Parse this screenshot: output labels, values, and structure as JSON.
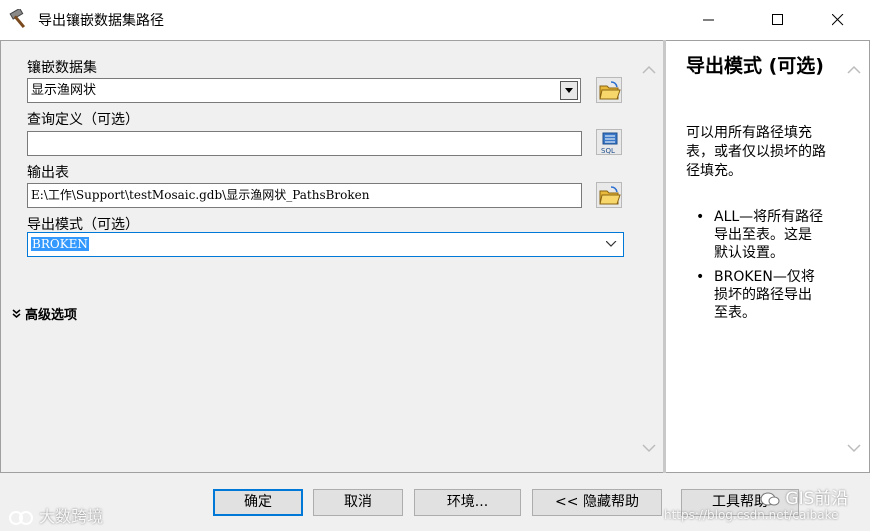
{
  "window": {
    "title": "导出镶嵌数据集路径",
    "icon": "hammer-icon",
    "controls": {
      "minimize": "minimize-icon",
      "maximize": "maximize-icon",
      "close": "close-icon"
    }
  },
  "form": {
    "mosaic_label": "镶嵌数据集",
    "mosaic_value": "显示渔网状",
    "query_label": "查询定义（可选）",
    "query_value": "",
    "output_label": "输出表",
    "output_value": "E:\\工作\\Support\\testMosaic.gdb\\显示渔网状_PathsBroken",
    "mode_label": "导出模式（可选）",
    "mode_value": "BROKEN",
    "advanced_label": "高级选项"
  },
  "help": {
    "title": "导出模式 (可选)",
    "intro": "可以用所有路径填充表，或者仅以损坏的路径填充。",
    "items": [
      "ALL—将所有路径导出至表。这是默认设置。",
      "BROKEN—仅将损坏的路径导出至表。"
    ]
  },
  "buttons": {
    "ok": "确定",
    "cancel": "取消",
    "env": "环境...",
    "hide_help": "<< 隐藏帮助",
    "tool_help": "工具帮助"
  },
  "watermarks": {
    "left": "大数跨境",
    "right": "GIS前沿",
    "url": "https://blog.csdn.net/caibake"
  },
  "colors": {
    "accent": "#0078d7",
    "selection": "#3399ff"
  }
}
